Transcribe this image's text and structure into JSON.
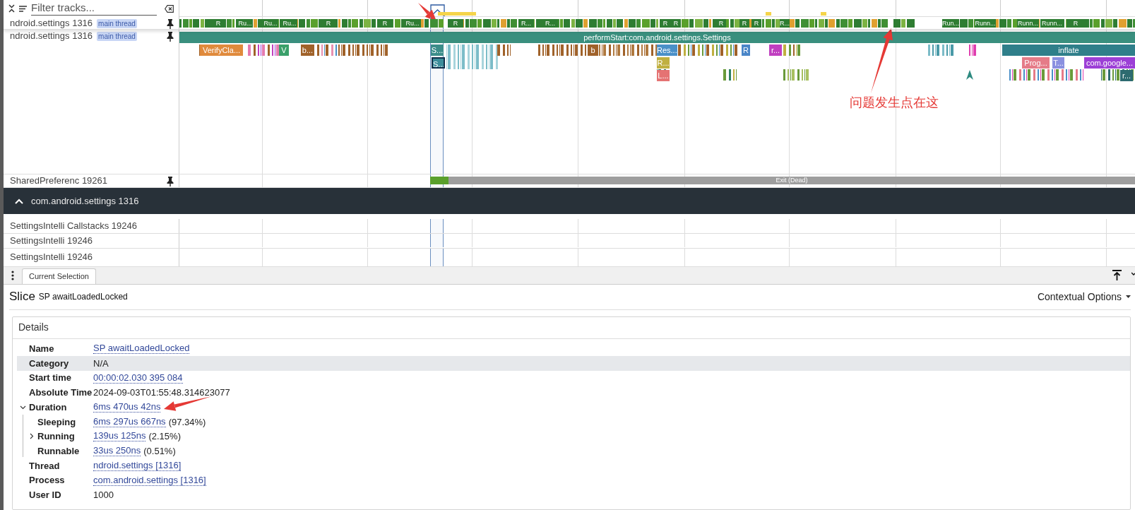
{
  "filter": {
    "placeholder": "Filter tracks..."
  },
  "pinned_tracks": [
    {
      "name": "ndroid.settings 1316",
      "tag": "main thread",
      "kind": "states",
      "pinned": true,
      "states": [
        "R",
        "Ru...",
        "Ru...",
        "Ru...",
        "R",
        "R",
        "Ru...",
        "R",
        "R...",
        "R...",
        "R",
        "R",
        "R",
        "R",
        "R",
        "R...",
        "Run...",
        "Runn...",
        "Runn...",
        "Runn...",
        "R"
      ]
    },
    {
      "name": "ndroid.settings 1316",
      "tag": "main thread",
      "kind": "slices",
      "pinned": true,
      "slice_rows": [
        {
          "slices": [
            {
              "label": "performStart:com.android.settings.Settings",
              "color": "#3a8f7e",
              "selected": false
            }
          ]
        },
        {
          "slices": [
            {
              "label": "VerifyCla...",
              "color": "#e08a3c",
              "selected": false
            },
            {
              "label": "V",
              "color": "#3aa06a",
              "selected": false
            },
            {
              "label": "b...",
              "color": "#a0622a",
              "selected": false
            },
            {
              "label": "S...",
              "color": "#3c8d8a",
              "selected": false
            },
            {
              "label": "b",
              "color": "#a0622a",
              "selected": false
            },
            {
              "label": "Res...",
              "color": "#4a90c8",
              "selected": false
            },
            {
              "label": "R",
              "color": "#4a86c8",
              "selected": false
            },
            {
              "label": "r...",
              "color": "#c040c0",
              "selected": false
            },
            {
              "label": "inflate",
              "color": "#2f7f8a",
              "selected": false
            }
          ]
        },
        {
          "slices": [
            {
              "label": "S...",
              "color": "#3c8d9a",
              "selected": true
            },
            {
              "label": "R...",
              "color": "#c0b040",
              "selected": false
            },
            {
              "label": "Prog...",
              "color": "#e57b88",
              "selected": false
            },
            {
              "label": "T...",
              "color": "#8a90e0",
              "selected": false
            },
            {
              "label": "com.google...",
              "color": "#9c3fd6",
              "selected": false
            }
          ]
        },
        {
          "slices": [
            {
              "label": "L...",
              "color": "#e57373",
              "selected": false
            },
            {
              "label": "r...",
              "color": "#2d6b70",
              "selected": false
            }
          ]
        }
      ]
    },
    {
      "name": "SharedPreferenc 19261",
      "kind": "exit",
      "pinned": true,
      "states": [
        "Exit (Dead)"
      ]
    }
  ],
  "process_group": {
    "title": "com.android.settings 1316",
    "expanded": true
  },
  "tracks": [
    {
      "name": "SettingsIntelli Callstacks 19246"
    },
    {
      "name": "SettingsIntelli 19246"
    },
    {
      "name": "SettingsIntelli 19246"
    }
  ],
  "panel": {
    "tabs": [
      {
        "label": "Current Selection",
        "selected": true
      }
    ],
    "heading": {
      "kind_label": "Slice",
      "title": "SP awaitLoadedLocked"
    },
    "menu": "Contextual Options",
    "details": {
      "title": "Details",
      "rows": [
        {
          "label": "Name",
          "value": "SP awaitLoadedLocked",
          "link": true
        },
        {
          "label": "Category",
          "value": "N/A",
          "link": false,
          "highlighted": true
        },
        {
          "label": "Start time",
          "value": "00:00:02.030 395 084",
          "link": true
        },
        {
          "label": "Absolute Time",
          "value": "2024-09-03T01:55:48.314623077",
          "link": false
        },
        {
          "label": "Duration",
          "value": "6ms 470us 42ns",
          "link": true,
          "expanded": true,
          "children": [
            {
              "label": "Sleeping",
              "value": "6ms 297us 667ns",
              "suffix": "(97.34%)",
              "link": true
            },
            {
              "label": "Running",
              "value": "139us 125ns",
              "suffix": "(2.15%)",
              "link": true,
              "expanded": false
            },
            {
              "label": "Runnable",
              "value": "33us 250ns",
              "suffix": "(0.51%)",
              "link": true
            }
          ]
        },
        {
          "label": "Thread",
          "value": "ndroid.settings [1316]",
          "link": true
        },
        {
          "label": "Process",
          "value": "com.android.settings [1316]",
          "link": true
        },
        {
          "label": "User ID",
          "value": "1000",
          "link": false
        }
      ]
    }
  },
  "annotation": {
    "text": "问题发生点在这"
  }
}
